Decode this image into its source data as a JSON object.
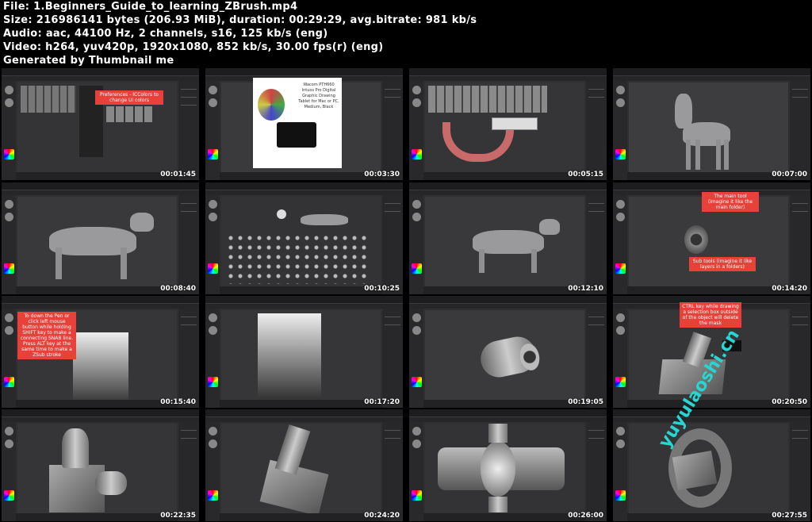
{
  "info": {
    "file": "File: 1.Beginners_Guide_to_learning_ZBrush.mp4",
    "size": "Size: 216986141 bytes (206.93 MiB), duration: 00:29:29, avg.bitrate: 981 kb/s",
    "audio": "Audio: aac, 44100 Hz, 2 channels, s16, 125 kb/s (eng)",
    "video": "Video: h264, yuv420p, 1920x1080, 852 kb/s, 30.00 fps(r) (eng)",
    "generated": "Generated by Thumbnail me"
  },
  "thumbnails": [
    {
      "time": "00:01:45",
      "note": "Preferences - ICColors to change UI colors"
    },
    {
      "time": "00:03:30",
      "note": "Wacom PTH660 Intuos Pro Digital Graphic Drawing Tablet for Mac or PC, Medium, Black"
    },
    {
      "time": "00:05:15",
      "note": ""
    },
    {
      "time": "00:07:00",
      "note": ""
    },
    {
      "time": "00:08:40",
      "note": ""
    },
    {
      "time": "00:10:25",
      "note": ""
    },
    {
      "time": "00:12:10",
      "note": ""
    },
    {
      "time": "00:14:20",
      "note": "The main tool (imagine it like the main folder)",
      "note2": "Sub tools (imagine it like layers in a folders)"
    },
    {
      "time": "00:15:40",
      "note": "To down the Pen or click left mouse button while holding SHIFT key to make a connecting SNAB line. Press ALT key at the same time to make a ZSub stroke"
    },
    {
      "time": "00:17:20",
      "note": ""
    },
    {
      "time": "00:19:05",
      "note": ""
    },
    {
      "time": "00:20:50",
      "note": "CTRL key while drawing a selection box outside of the object will delete the mask"
    },
    {
      "time": "00:22:35",
      "note": ""
    },
    {
      "time": "00:24:20",
      "note": ""
    },
    {
      "time": "00:26:00",
      "note": ""
    },
    {
      "time": "00:27:55",
      "note": ""
    }
  ],
  "watermark": "yuyulaoshi.cn"
}
